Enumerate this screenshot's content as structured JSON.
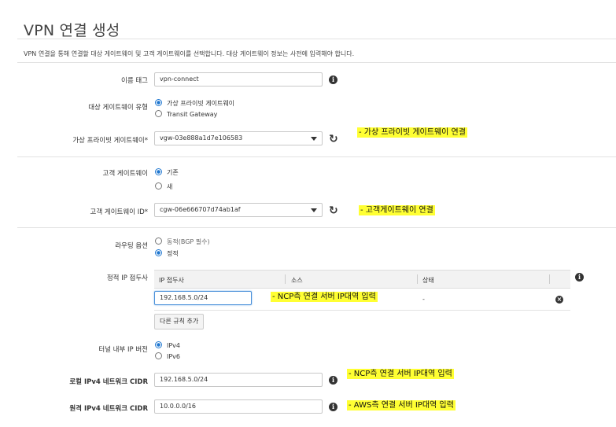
{
  "page": {
    "title": "VPN 연결 생성",
    "description": "VPN 연결을 통해 연결할 대상 게이트웨이 및 고객 게이트웨이를 선택합니다. 대상 게이트웨이 정보는 사전에 입력해야 합니다."
  },
  "name_tag": {
    "label": "이름 태그",
    "value": "vpn-connect"
  },
  "target_gateway_type": {
    "label": "대상 게이트웨이 유형",
    "options": [
      {
        "label": "가상 프라이빗 게이트웨이",
        "selected": true
      },
      {
        "label": "Transit Gateway",
        "selected": false
      }
    ]
  },
  "virtual_private_gateway": {
    "label": "가상 프라이빗 게이트웨이*",
    "value": "vgw-03e888a1d7e106583"
  },
  "customer_gateway": {
    "label": "고객 게이트웨이",
    "options": [
      {
        "label": "기존",
        "selected": true
      },
      {
        "label": "새",
        "selected": false
      }
    ]
  },
  "customer_gateway_id": {
    "label": "고객 게이트웨이 ID*",
    "value": "cgw-06e666707d74ab1af"
  },
  "routing_options": {
    "label": "라우팅 옵션",
    "options": [
      {
        "label": "동적(BGP 필수)",
        "selected": false
      },
      {
        "label": "정적",
        "selected": true
      }
    ]
  },
  "static_ip_prefix": {
    "label": "정적 IP 접두사",
    "columns": [
      "IP 접두사",
      "소스",
      "상태"
    ],
    "rows": [
      {
        "ip_prefix": "192.168.5.0/24",
        "source": "",
        "status": "-"
      }
    ],
    "add_button": "다른 규칙 추가"
  },
  "tunnel_ip_version": {
    "label": "터널 내부 IP 버전",
    "options": [
      {
        "label": "IPv4",
        "selected": true
      },
      {
        "label": "IPv6",
        "selected": false
      }
    ]
  },
  "local_cidr": {
    "label": "로컬 IPv4 네트워크 CIDR",
    "value": "192.168.5.0/24"
  },
  "remote_cidr": {
    "label": "원격 IPv4 네트워크 CIDR",
    "value": "10.0.0.0/16"
  },
  "annotations": {
    "vgw": "- 가상 프라이빗 게이트웨이 연결",
    "cgw": "- 고객게이트웨이 연결",
    "prefix": "- NCP측 연결 서버 IP대역 입력",
    "local": "- NCP측 연결 서버 IP대역 입력",
    "remote": "- AWS측 연결 서버 IP대역 입력"
  },
  "icons": {
    "info": "info-icon",
    "refresh": "refresh-icon",
    "remove": "remove-icon",
    "dropdown": "chevron-down-icon"
  },
  "colors": {
    "highlight": "#ffff33",
    "radio_selected": "#1f77d0",
    "focus_border": "#4a90d9"
  }
}
